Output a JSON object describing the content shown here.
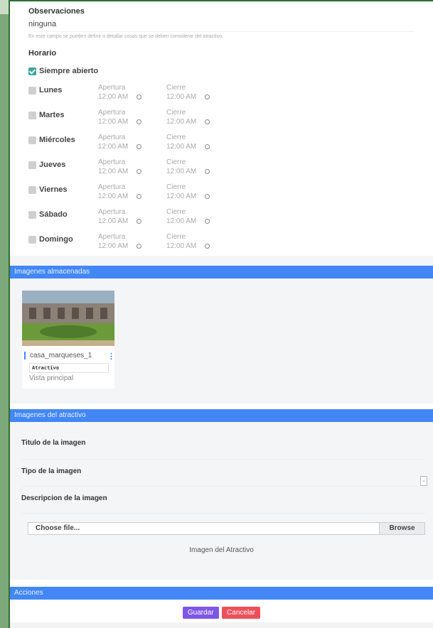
{
  "observaciones": {
    "label": "Observaciones",
    "value": "ninguna",
    "help": "En este campo se pueden definir o detallar cosas que se deben considerar del atractivo."
  },
  "horario": {
    "label": "Horario",
    "always_open": "Siempre abierto",
    "open_caption": "Apertura",
    "close_caption": "Cierre",
    "days": [
      {
        "name": "Lunes",
        "open": "12:00 AM",
        "close": "12:00 AM"
      },
      {
        "name": "Martes",
        "open": "12:00 AM",
        "close": "12:00 AM"
      },
      {
        "name": "Miércoles",
        "open": "12:00 AM",
        "close": "12:00 AM"
      },
      {
        "name": "Jueves",
        "open": "12:00 AM",
        "close": "12:00 AM"
      },
      {
        "name": "Viernes",
        "open": "12:00 AM",
        "close": "12:00 AM"
      },
      {
        "name": "Sábado",
        "open": "12:00 AM",
        "close": "12:00 AM"
      },
      {
        "name": "Domingo",
        "open": "12:00 AM",
        "close": "12:00 AM"
      }
    ]
  },
  "stored": {
    "title": "Imagenes almacenadas",
    "filename": "casa_marqueses_1",
    "type": "Atractivo",
    "subtitle": "Vista principal"
  },
  "attraction_images": {
    "title": "Imagenes del atractivo",
    "title_label": "Titulo de la imagen",
    "type_label": "Tipo de la imagen",
    "desc_label": "Descripcion de la imagen",
    "file_placeholder": "Choose file...",
    "browse": "Browse",
    "preview_caption": "Imagen del Atractivo"
  },
  "actions": {
    "title": "Acciones",
    "save": "Guardar",
    "cancel": "Cancelar"
  },
  "colors": {
    "band": "#4287f5",
    "save": "#7e57e6",
    "cancel": "#ef4f5a",
    "check": "#3ba69a"
  }
}
